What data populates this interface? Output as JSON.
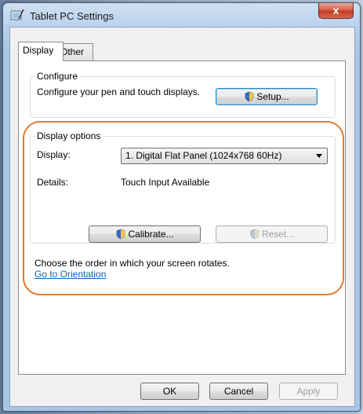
{
  "window": {
    "title": "Tablet PC Settings",
    "close_label": "x"
  },
  "tabs": [
    {
      "label": "Display"
    },
    {
      "label": "Other"
    }
  ],
  "configure": {
    "legend": "Configure",
    "description": "Configure your pen and touch displays.",
    "setup_label": "Setup..."
  },
  "display_options": {
    "legend": "Display options",
    "display_label": "Display:",
    "display_value": "1. Digital Flat Panel (1024x768 60Hz)",
    "details_label": "Details:",
    "details_value": "Touch Input Available",
    "calibrate_label": "Calibrate...",
    "reset_label": "Reset..."
  },
  "orientation": {
    "text": "Choose the order in which your screen rotates.",
    "link": "Go to Orientation"
  },
  "footer": {
    "ok_label": "OK",
    "cancel_label": "Cancel",
    "apply_label": "Apply"
  },
  "colors": {
    "highlight": "#e07a2e",
    "link": "#0066cc"
  }
}
